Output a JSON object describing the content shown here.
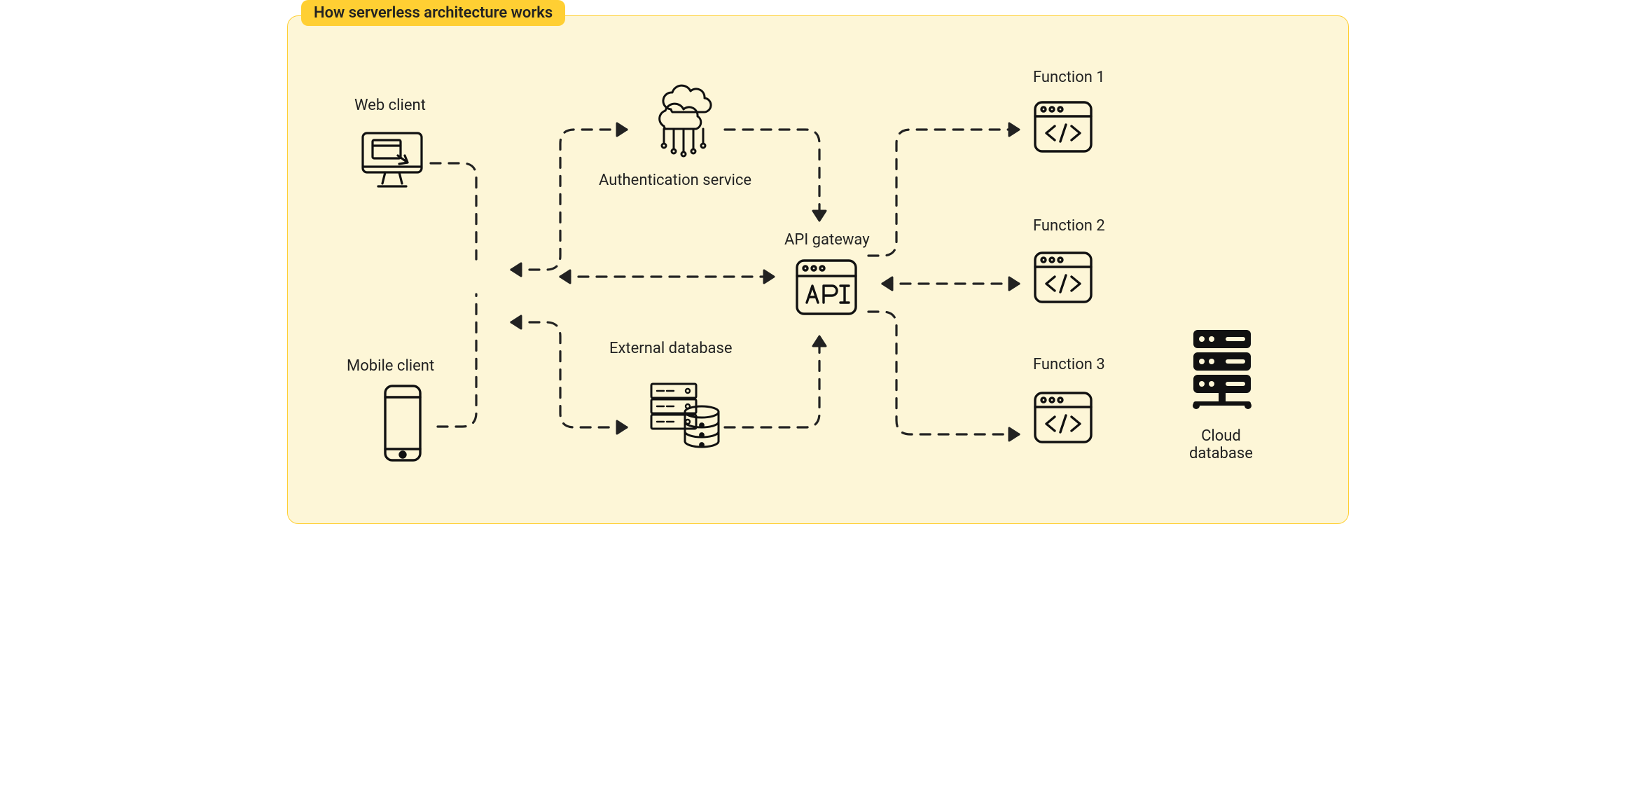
{
  "title": "How serverless architecture works",
  "nodes": {
    "web_client": "Web client",
    "mobile_client": "Mobile client",
    "auth_service": "Authentication service",
    "external_db": "External database",
    "api_gateway": "API gateway",
    "function1": "Function 1",
    "function2": "Function 2",
    "function3": "Function 3",
    "cloud_db": "Cloud\ndatabase"
  },
  "connections": [
    "web_client -> client_bus",
    "mobile_client -> client_bus",
    "client_bus <-> api_gateway",
    "client_bus -> auth_service",
    "client_bus -> external_db",
    "auth_service -> api_gateway",
    "external_db -> api_gateway",
    "api_gateway -> function1",
    "api_gateway <-> function2",
    "api_gateway -> function3"
  ]
}
